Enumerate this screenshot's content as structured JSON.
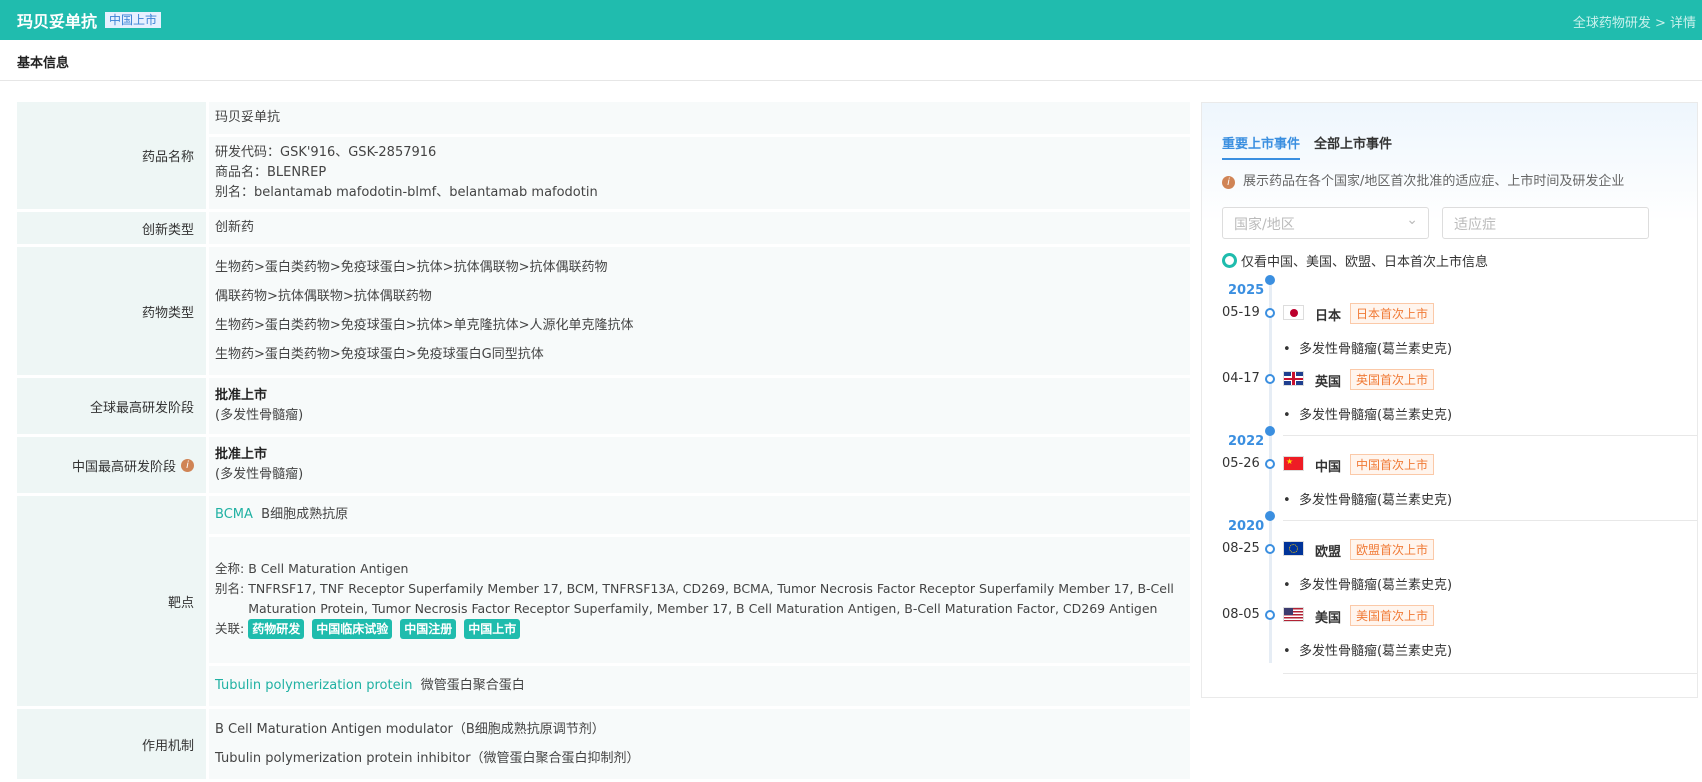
{
  "header": {
    "title": "玛贝妥单抗",
    "tag": "中国上市",
    "breadcrumb": "全球药物研发 > 详情"
  },
  "section_title": "基本信息",
  "basic": {
    "name_label": "药品名称",
    "name": "玛贝妥单抗",
    "code": "研发代码：GSK'916、GSK-2857916",
    "trade": "商品名：BLENREP",
    "alias": "别名：belantamab mafodotin-blmf、belantamab mafodotin",
    "innov_label": "创新类型",
    "innov": "创新药",
    "type_label": "药物类型",
    "types": [
      "生物药>蛋白类药物>免疫球蛋白>抗体>抗体偶联物>抗体偶联药物",
      "偶联药物>抗体偶联物>抗体偶联药物",
      "生物药>蛋白类药物>免疫球蛋白>抗体>单克隆抗体>人源化单克隆抗体",
      "生物药>蛋白类药物>免疫球蛋白>免疫球蛋白G同型抗体"
    ],
    "global_label": "全球最高研发阶段",
    "global_stage": "批准上市",
    "global_ind": "(多发性骨髓瘤)",
    "china_label": "中国最高研发阶段",
    "china_stage": "批准上市",
    "china_ind": "(多发性骨髓瘤)",
    "target_label": "靶点",
    "t1_code": "BCMA",
    "t1_name": "B细胞成熟抗原",
    "full_label": "全称:",
    "full": "B Cell Maturation Antigen",
    "alias_label": "别名:",
    "t1_alias": "TNFRSF17, TNF Receptor Superfamily Member 17, BCM, TNFRSF13A, CD269, BCMA, Tumor Necrosis Factor Receptor Superfamily Member 17, B-Cell Maturation Protein, Tumor Necrosis Factor Receptor Superfamily, Member 17, B Cell Maturation Antigen, B-Cell Maturation Factor, CD269 Antigen",
    "rel_label": "关联:",
    "chips": [
      "药物研发",
      "中国临床试验",
      "中国注册",
      "中国上市"
    ],
    "t2_code": "Tubulin polymerization protein",
    "t2_name": "微管蛋白聚合蛋白",
    "moa_label": "作用机制",
    "moa": [
      "B Cell Maturation Antigen modulator（B细胞成熟抗原调节剂）",
      "Tubulin polymerization protein inhibitor（微管蛋白聚合蛋白抑制剂）"
    ]
  },
  "panel": {
    "tabs": [
      "重要上市事件",
      "全部上市事件"
    ],
    "note": "展示药品在各个国家/地区首次批准的适应症、上市时间及研发企业",
    "country_placeholder": "国家/地区",
    "ind_placeholder": "适应症",
    "check": "仅看中国、美国、欧盟、日本首次上市信息",
    "years": [
      "2025",
      "2022",
      "2020"
    ],
    "events": [
      {
        "date": "05-19",
        "country": "日本",
        "badge": "日本首次上市",
        "ind": "多发性骨髓瘤(葛兰素史克)"
      },
      {
        "date": "04-17",
        "country": "英国",
        "badge": "英国首次上市",
        "ind": "多发性骨髓瘤(葛兰素史克)"
      },
      {
        "date": "05-26",
        "country": "中国",
        "badge": "中国首次上市",
        "ind": "多发性骨髓瘤(葛兰素史克)"
      },
      {
        "date": "08-25",
        "country": "欧盟",
        "badge": "欧盟首次上市",
        "ind": "多发性骨髓瘤(葛兰素史克)"
      },
      {
        "date": "08-05",
        "country": "美国",
        "badge": "美国首次上市",
        "ind": "多发性骨髓瘤(葛兰素史克)"
      }
    ],
    "colors": {
      "accent": "#3b8fe0",
      "teal": "#1fbcad",
      "badge": "#f07a36"
    }
  }
}
